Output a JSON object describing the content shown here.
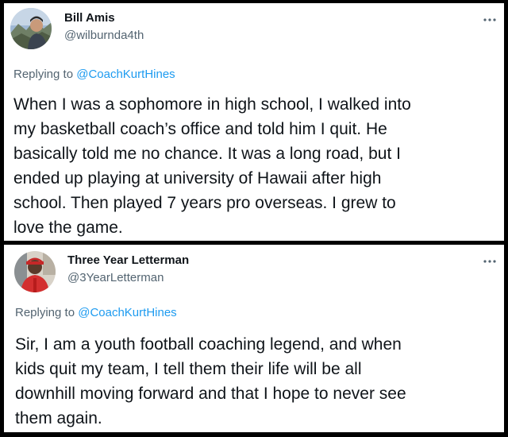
{
  "tweets": [
    {
      "display_name": "Bill Amis",
      "handle": "@wilburnda4th",
      "avatar_icon": "user-photo-avatar-icon",
      "reply_prefix": "Replying to ",
      "reply_to": "@CoachKurtHines",
      "text": "When I was a sophomore in high school, I walked into\nmy basketball coach’s office and told him I quit. He\nbasically told me no chance. It was a long road, but I\nended up playing at university of Hawaii after high\nschool. Then played 7 years pro overseas. I grew to\nlove the game.",
      "more_icon": "more-options-icon"
    },
    {
      "display_name": "Three Year Letterman",
      "handle": "@3YearLetterman",
      "avatar_icon": "user-photo-avatar-icon",
      "reply_prefix": "Replying to ",
      "reply_to": "@CoachKurtHines",
      "text": "Sir, I am a youth football coaching legend, and when\nkids quit my team, I tell them their life will be all\ndownhill moving forward and that I hope to never see\nthem again.",
      "more_icon": "more-options-icon"
    }
  ],
  "colors": {
    "background": "#000000",
    "card": "#ffffff",
    "primary_text": "#0f1419",
    "secondary_text": "#536471",
    "link": "#1d9bf0"
  }
}
